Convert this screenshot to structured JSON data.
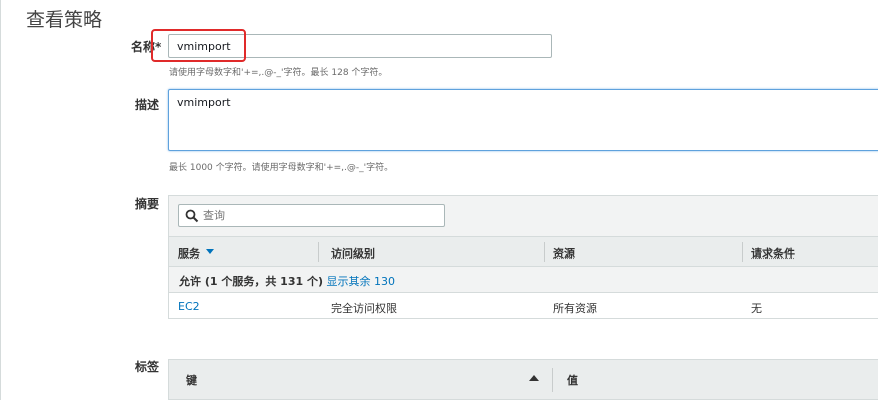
{
  "page": {
    "title": "查看策略"
  },
  "name_field": {
    "label": "名称*",
    "value": "vmimport",
    "help": "请使用字母数字和'+=,.@-_'字符。最长 128 个字符。"
  },
  "description_field": {
    "label": "描述",
    "value": "vmimport",
    "help": "最长 1000 个字符。请使用字母数字和'+=,.@-_'字符。"
  },
  "summary": {
    "label": "摘要",
    "search_placeholder": "查询",
    "columns": [
      "服务",
      "访问级别",
      "资源",
      "请求条件"
    ],
    "group": {
      "allow_text": "允许 (1 个服务，共 131 个)",
      "show_more": "显示其余 130"
    },
    "rows": [
      {
        "service": "EC2",
        "access": "完全访问权限",
        "resource": "所有资源",
        "condition": "无"
      }
    ]
  },
  "tags": {
    "label": "标签",
    "columns": [
      "键",
      "值"
    ]
  },
  "colors": {
    "link": "#0073bb",
    "highlight": "#e02a2a",
    "focus": "#5fa2dd"
  }
}
